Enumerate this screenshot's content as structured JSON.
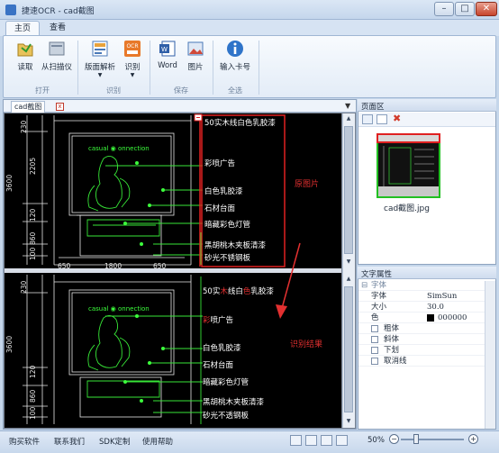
{
  "window": {
    "title": "捷速OCR - cad截图",
    "minimize": "–",
    "maximize": "□",
    "close": "✕"
  },
  "ribbon": {
    "tabs": [
      {
        "label": "主页"
      },
      {
        "label": "查看"
      }
    ],
    "buttons": {
      "read": "读取",
      "scan": "从扫描仪",
      "layout": "版面解析",
      "recognize": "识别",
      "word": "Word",
      "image": "图片",
      "enter_key": "输入卡号"
    },
    "groups": {
      "open": "打开",
      "recognize": "识别",
      "save": "保存",
      "full": "全选"
    }
  },
  "document": {
    "tab_label": "cad截图",
    "tab_close": "x",
    "dropdown": "▼",
    "top_texts": [
      "50实木线白色乳胶漆",
      "彩喷广告",
      "白色乳胶漆",
      "石材台面",
      "暗藏彩色灯管",
      "黑胡桃木夹板清漆",
      "砂光不锈钢板"
    ],
    "bottom_texts": [
      "50实",
      "线白",
      "乳胶漆",
      "喷广告",
      "白色乳胶漆",
      "石材台面",
      "暗藏彩色灯管",
      "黑胡桃木夹板清漆",
      "砂光不透钢板"
    ],
    "top_label": "原图片",
    "bottom_label": "识别结果",
    "sign_text": "casual ◉ onnection",
    "dims_bottom": [
      "650",
      "1800",
      "650"
    ],
    "dims_left": [
      "2205",
      "120",
      "860",
      "100",
      "3600",
      "230"
    ],
    "dims_left_bottom": [
      "3600",
      "120",
      "860",
      "100",
      "230"
    ]
  },
  "page_panel": {
    "title": "页面区",
    "caption": "cad截图.jpg"
  },
  "props_panel": {
    "title": "文字属性",
    "section": "字体",
    "rows": [
      {
        "key": "字体",
        "value": "SimSun"
      },
      {
        "key": "大小",
        "value": "30.0"
      },
      {
        "key": "色",
        "value": "000000"
      }
    ],
    "checks": [
      "粗体",
      "斜体",
      "下划",
      "取消线"
    ]
  },
  "statusbar": {
    "links": [
      "购买软件",
      "联系我们",
      "SDK定制",
      "使用帮助"
    ],
    "zoom": "50%",
    "minus": "−",
    "plus": "+"
  },
  "colors": {
    "accent": "#3a73c4",
    "red": "#e23030",
    "green": "#3cff3c"
  }
}
